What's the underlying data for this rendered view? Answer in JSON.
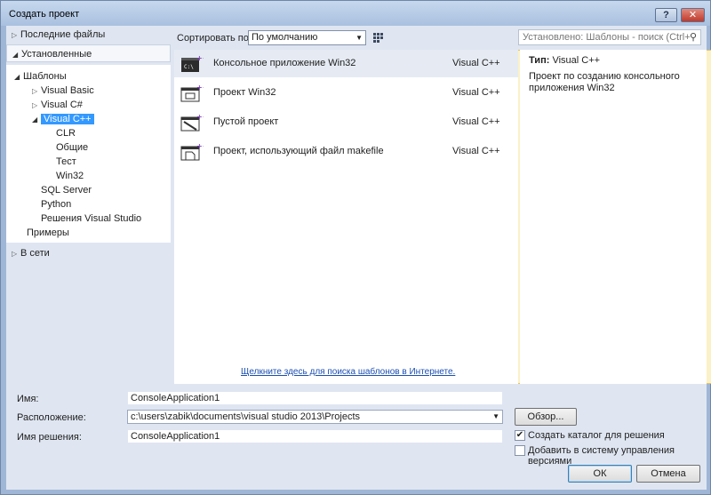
{
  "window": {
    "title": "Создать проект",
    "help_label": "?",
    "close_label": "✕"
  },
  "left": {
    "recent": "Последние файлы",
    "installed": "Установленные",
    "tree": {
      "templates": "Шаблоны",
      "visual_basic": "Visual Basic",
      "visual_csharp": "Visual C#",
      "visual_cpp": "Visual C++",
      "clr": "CLR",
      "general": "Общие",
      "test": "Тест",
      "win32": "Win32",
      "sql_server": "SQL Server",
      "python": "Python",
      "vs_solutions": "Решения Visual Studio",
      "samples": "Примеры"
    },
    "online": "В сети"
  },
  "toolbar": {
    "sort_label": "Сортировать по:",
    "sort_value": "По умолчанию",
    "search_placeholder": "Установлено: Шаблоны - поиск (Ctrl+"
  },
  "templates": [
    {
      "name": "Консольное приложение Win32",
      "lang": "Visual C++"
    },
    {
      "name": "Проект Win32",
      "lang": "Visual C++"
    },
    {
      "name": "Пустой проект",
      "lang": "Visual C++"
    },
    {
      "name": "Проект, использующий файл makefile",
      "lang": "Visual C++"
    }
  ],
  "online_link": "Щелкните здесь для поиска шаблонов в Интернете.",
  "info": {
    "type_label": "Тип:",
    "type_value": "Visual C++",
    "description": "Проект по созданию консольного приложения Win32"
  },
  "form": {
    "name_label": "Имя:",
    "name_value": "ConsoleApplication1",
    "location_label": "Расположение:",
    "location_value": "c:\\users\\zabik\\documents\\visual studio 2013\\Projects",
    "solution_label": "Имя решения:",
    "solution_value": "ConsoleApplication1",
    "browse_label": "Обзор...",
    "create_dir_label": "Создать каталог для решения",
    "create_dir_checked": true,
    "add_vcs_label": "Добавить в систему управления версиями",
    "add_vcs_checked": false,
    "ok_label": "ОК",
    "cancel_label": "Отмена"
  },
  "colors": {
    "selection": "#3399ff",
    "frame": "#9fb6d6",
    "client": "#dfe6f1",
    "link": "#1b4fb3"
  }
}
